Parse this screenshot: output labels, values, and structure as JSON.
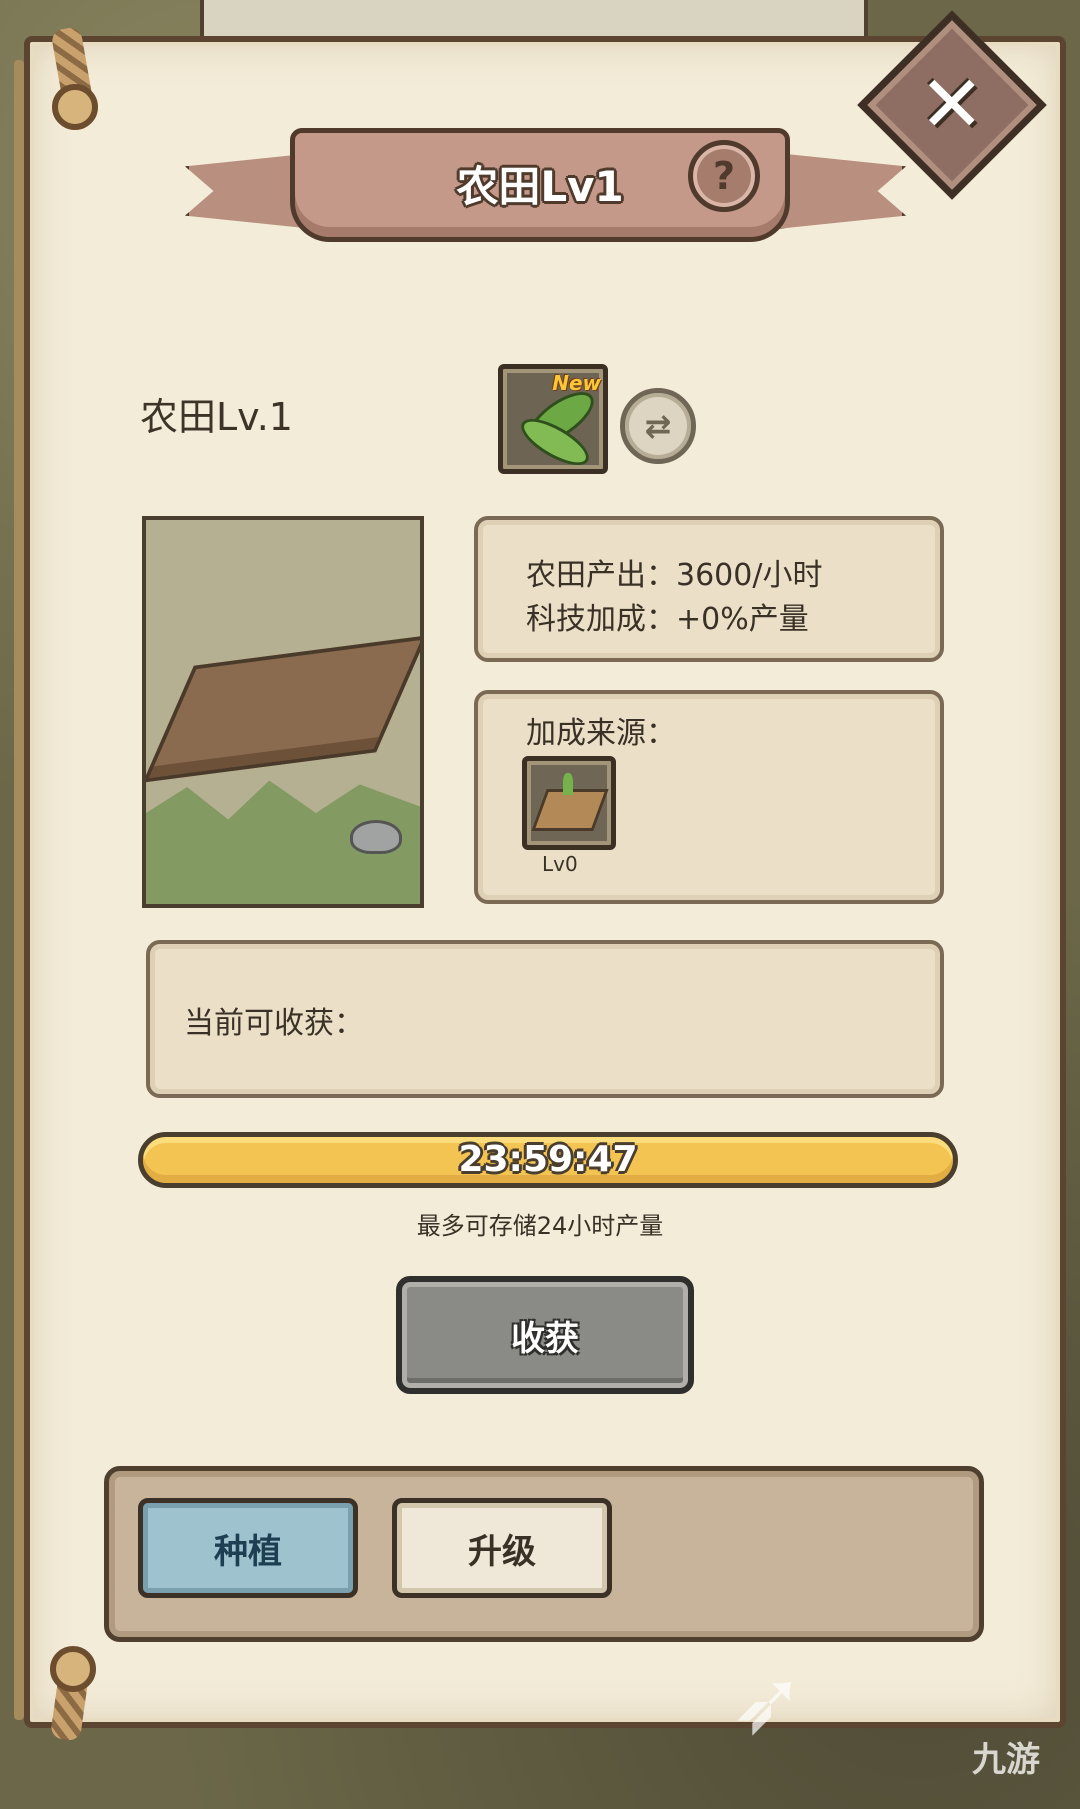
{
  "header": {
    "title": "农田Lv1",
    "help_icon": "?",
    "close_icon": "✕"
  },
  "building": {
    "level_label": "农田Lv.1",
    "crop_badge": "New",
    "swap_icon": "⇄"
  },
  "stats": {
    "output": "农田产出：3600/小时",
    "tech_bonus": "科技加成：+0%产量"
  },
  "bonus": {
    "title": "加成来源：",
    "items": [
      {
        "level": "Lv0"
      }
    ]
  },
  "harvest": {
    "label": "当前可收获："
  },
  "timer": {
    "value": "23:59:47",
    "progress": 1.0,
    "note": "最多可存储24小时产量"
  },
  "actions": {
    "harvest_button": "收获"
  },
  "tabs": [
    {
      "label": "种植",
      "active": true
    },
    {
      "label": "升级",
      "active": false
    }
  ],
  "watermark": {
    "text": "九游"
  },
  "colors": {
    "progress": "#f0b93f",
    "active_tab": "#9fc2cf",
    "banner": "#c4998a"
  }
}
